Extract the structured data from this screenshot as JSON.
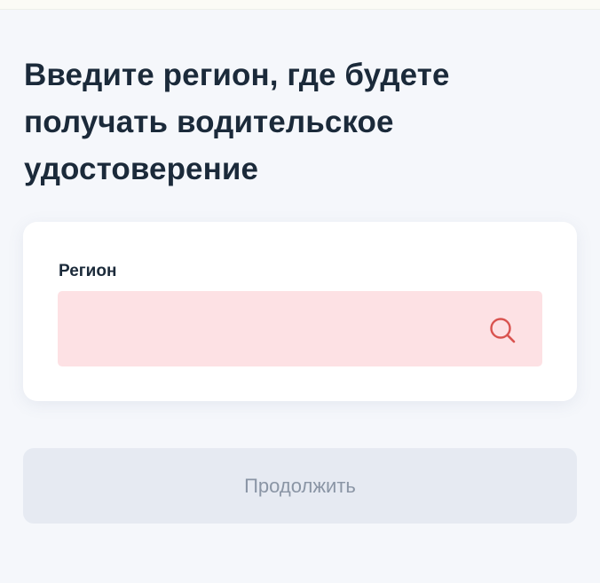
{
  "page": {
    "title": "Введите регион, где будете получать водительское удостоверение"
  },
  "form": {
    "region_label": "Регион",
    "region_value": "",
    "region_placeholder": "",
    "search_icon": "search-icon"
  },
  "actions": {
    "continue_label": "Продолжить"
  },
  "colors": {
    "background": "#f5f7fb",
    "card": "#ffffff",
    "input_error_bg": "#fde1e4",
    "search_icon": "#d9534f",
    "button_disabled_bg": "#e6eaf2",
    "button_disabled_text": "#8a95a5",
    "text": "#1b2a3a"
  }
}
